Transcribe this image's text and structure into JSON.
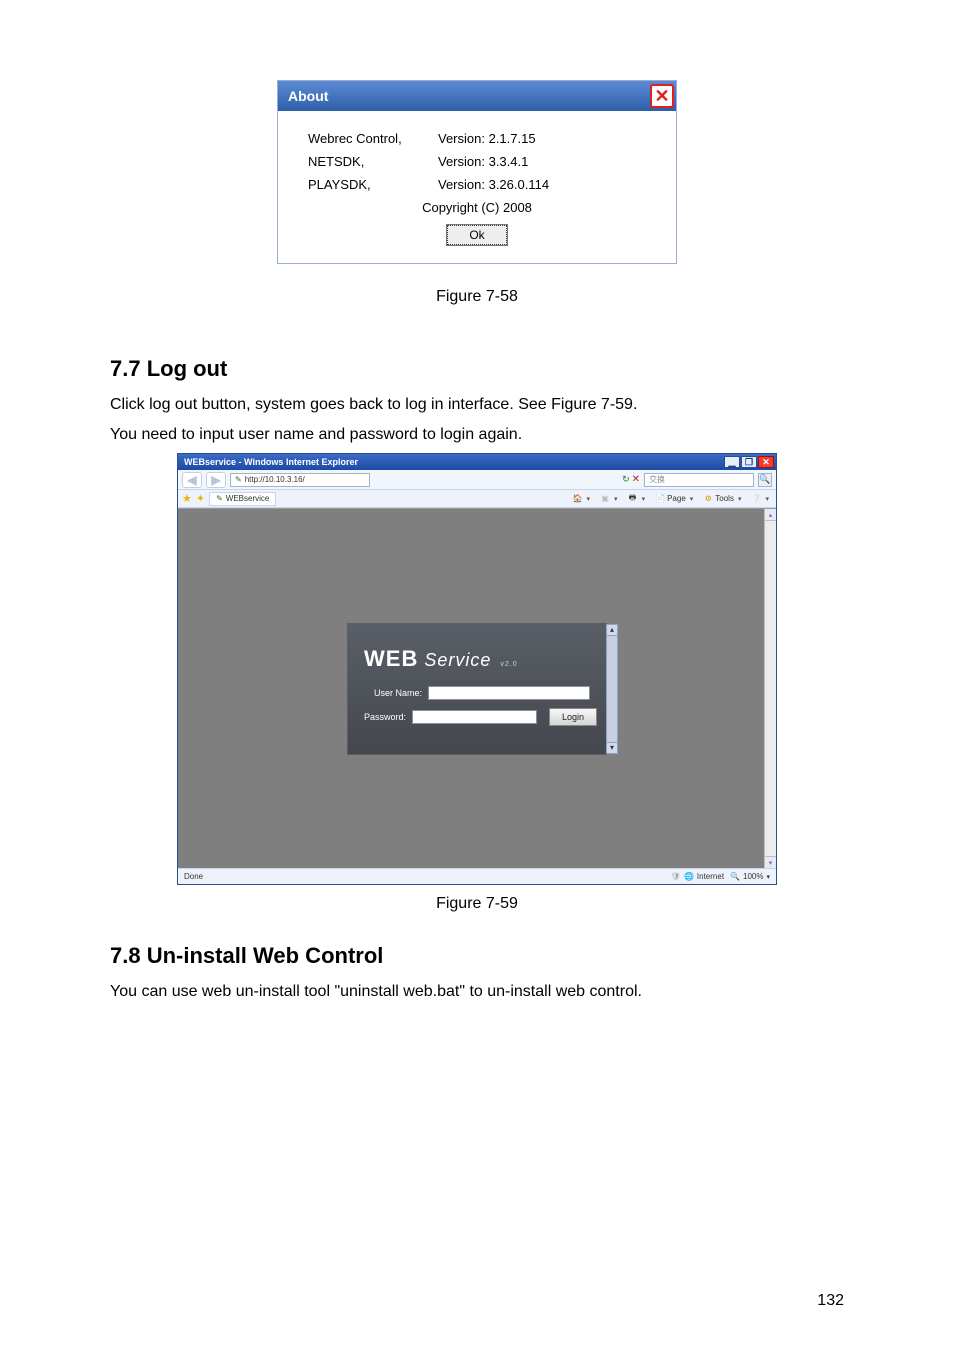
{
  "about": {
    "title": "About",
    "rows": [
      {
        "name": "Webrec Control,",
        "ver": "Version: 2.1.7.15"
      },
      {
        "name": "NETSDK,",
        "ver": "Version: 3.3.4.1"
      },
      {
        "name": "PLAYSDK,",
        "ver": "Version: 3.26.0.114"
      }
    ],
    "copyright": "Copyright (C) 2008",
    "ok": "Ok"
  },
  "fig758_caption": "Figure 7-58",
  "sec77": {
    "heading": "7.7  Log out",
    "p1": "Click log out button, system goes back to log in interface. See Figure 7-59.",
    "p2": "You need to input user name and password to login again."
  },
  "browser": {
    "title": "WEBservice - Windows Internet Explorer",
    "url": "http://10.10.3.16/",
    "search_placeholder": "交换",
    "tab_name": "WEBservice",
    "toolbar": {
      "page": "Page",
      "tools": "Tools"
    },
    "login": {
      "logo_a": "WEB",
      "logo_b": "Service",
      "logo_ver": "v2.0",
      "user_lbl": "User Name:",
      "pass_lbl": "Password:",
      "login_btn": "Login"
    },
    "status_left": "Done",
    "status_zone": "Internet",
    "status_zoom": "100%"
  },
  "fig759_caption": "Figure 7-59",
  "sec78": {
    "heading": "7.8  Un-install Web Control",
    "p1": "You can use web un-install tool \"uninstall web.bat\" to un-install web control."
  },
  "page_number": "132"
}
